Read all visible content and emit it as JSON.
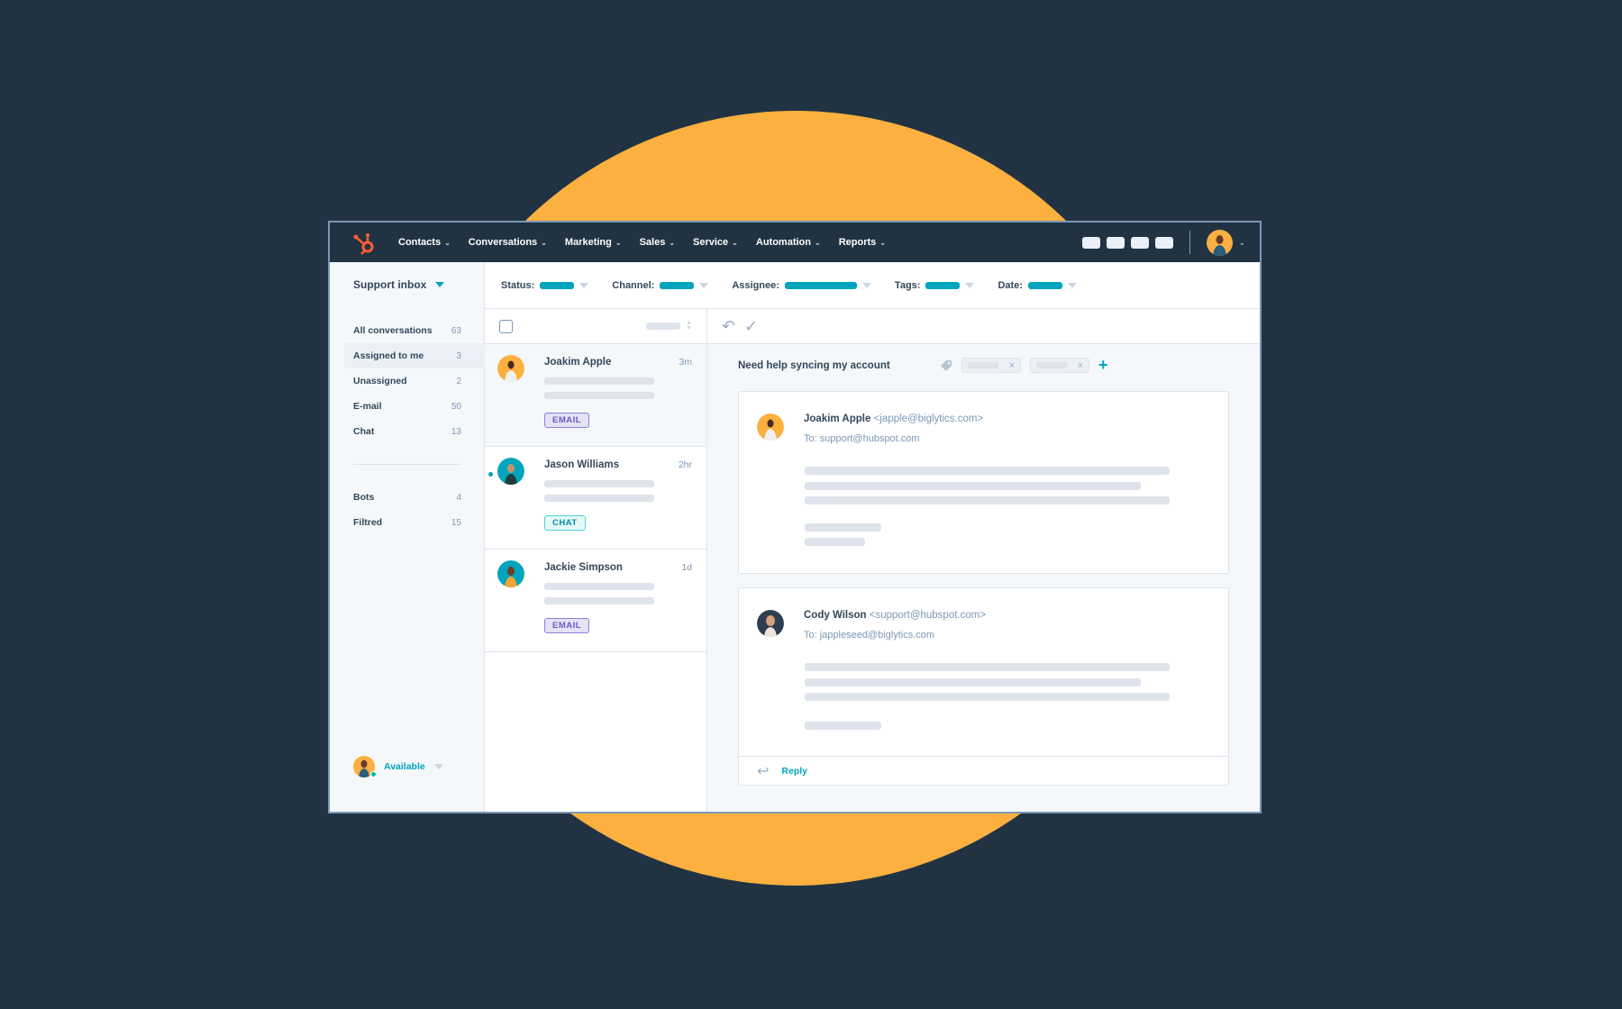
{
  "nav": {
    "items": [
      {
        "label": "Contacts"
      },
      {
        "label": "Conversations"
      },
      {
        "label": "Marketing"
      },
      {
        "label": "Sales"
      },
      {
        "label": "Service"
      },
      {
        "label": "Automation"
      },
      {
        "label": "Reports"
      }
    ],
    "chevron": "⌄"
  },
  "sidebar": {
    "inbox_title": "Support inbox",
    "items": [
      {
        "label": "All conversations",
        "count": "63"
      },
      {
        "label": "Assigned to me",
        "count": "3"
      },
      {
        "label": "Unassigned",
        "count": "2"
      },
      {
        "label": "E-mail",
        "count": "50"
      },
      {
        "label": "Chat",
        "count": "13"
      }
    ],
    "items2": [
      {
        "label": "Bots",
        "count": "4"
      },
      {
        "label": "Filtred",
        "count": "15"
      }
    ],
    "status": "Available"
  },
  "filters": [
    {
      "label": "Status:"
    },
    {
      "label": "Channel:"
    },
    {
      "label": "Assignee:"
    },
    {
      "label": "Tags:"
    },
    {
      "label": "Date:"
    }
  ],
  "conversations": [
    {
      "name": "Joakim Apple",
      "time": "3m",
      "tag": "EMAIL"
    },
    {
      "name": "Jason Williams",
      "time": "2hr",
      "tag": "CHAT"
    },
    {
      "name": "Jackie Simpson",
      "time": "1d",
      "tag": "EMAIL"
    }
  ],
  "detail": {
    "subject": "Need help syncing my account",
    "messages": [
      {
        "sender": "Joakim Apple",
        "sender_email": "<japple@biglytics.com>",
        "to": "To: support@hubspot.com"
      },
      {
        "sender": "Cody Wilson",
        "sender_email": "<support@hubspot.com>",
        "to": "To: jappleseed@biglytics.com"
      }
    ],
    "reply_label": "Reply"
  },
  "colors": {
    "background": "#213343",
    "accent_circle": "#fbb040",
    "brand_teal": "#00a4bd",
    "logo_orange": "#ff5c35"
  }
}
